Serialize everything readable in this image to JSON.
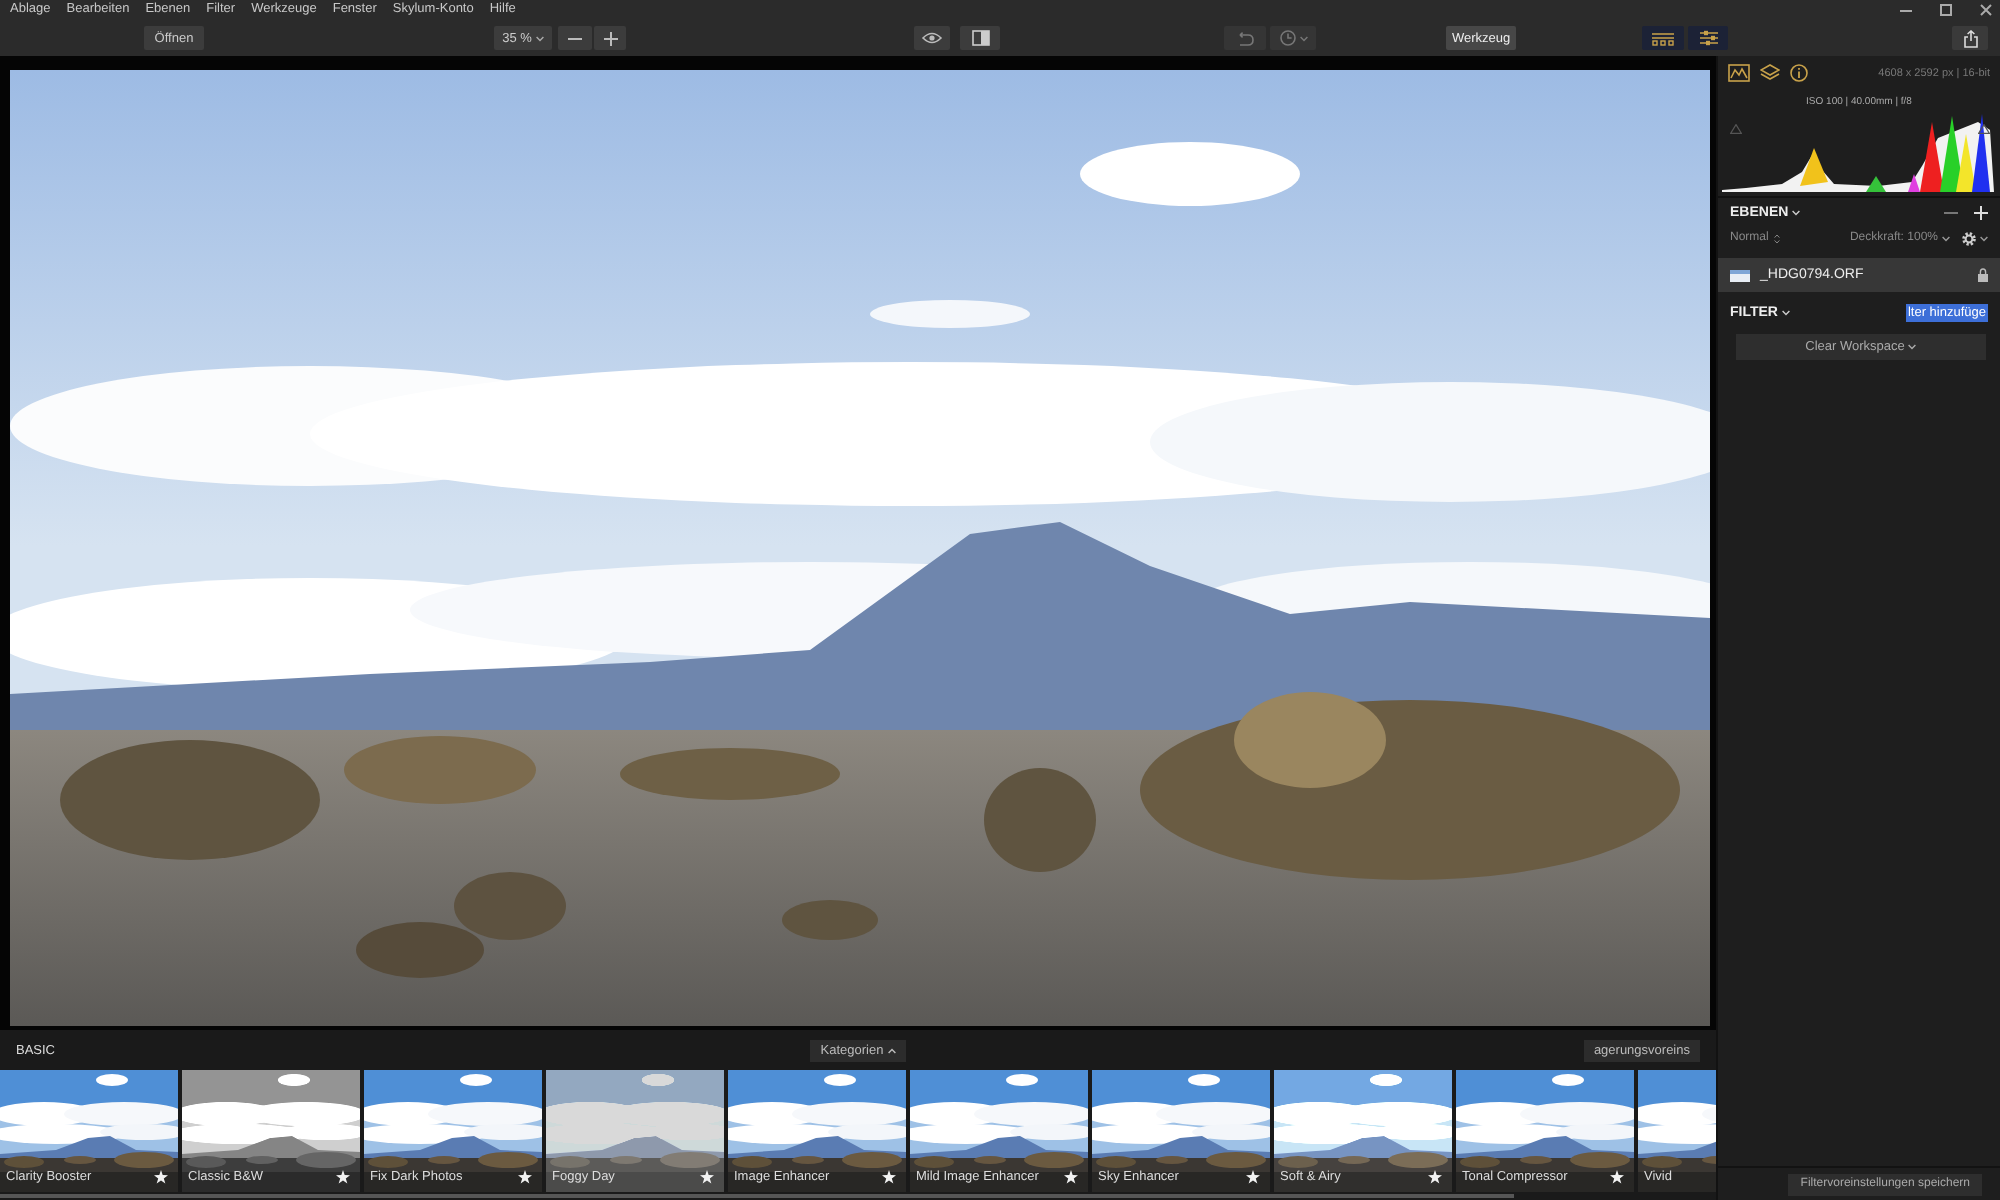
{
  "menu_bar": {
    "items": [
      "Ablage",
      "Bearbeiten",
      "Ebenen",
      "Filter",
      "Werkzeuge",
      "Fenster",
      "Skylum-Konto",
      "Hilfe"
    ]
  },
  "toolbar": {
    "open_button": "Öffnen",
    "zoom": "35 %",
    "tools_button": "Werkzeug"
  },
  "info": {
    "dimensions": "4608 x 2592 px | 16-bit",
    "exif": "ISO 100 | 40.00mm | f/8"
  },
  "layers": {
    "title": "EBENEN",
    "blend_mode": "Normal",
    "opacity": "Deckkraft: 100%",
    "items": [
      {
        "name": "_HDG0794.ORF",
        "selected": true
      }
    ]
  },
  "filters": {
    "title": "FILTER",
    "add_filter": {
      "label": "lter hinzufüge",
      "highlighted": true
    },
    "workspace_button": "Clear Workspace"
  },
  "presets": {
    "category": "BASIC",
    "categories_button": "Kategorien",
    "overlay_button": "agerungsvoreins",
    "items": [
      {
        "name": "Clarity Booster",
        "kind": "color",
        "favorite": true
      },
      {
        "name": "Classic B&W",
        "kind": "mono",
        "favorite": true
      },
      {
        "name": "Fix Dark Photos",
        "kind": "color",
        "favorite": true
      },
      {
        "name": "Foggy Day",
        "kind": "faded",
        "favorite": true
      },
      {
        "name": "Image Enhancer",
        "kind": "color",
        "favorite": true
      },
      {
        "name": "Mild Image Enhancer",
        "kind": "color",
        "favorite": true
      },
      {
        "name": "Sky Enhancer",
        "kind": "color",
        "favorite": true
      },
      {
        "name": "Soft & Airy",
        "kind": "bright",
        "favorite": true
      },
      {
        "name": "Tonal Compressor",
        "kind": "color",
        "favorite": true
      },
      {
        "name": "Vivid",
        "kind": "color",
        "favorite": false
      }
    ],
    "save_button": "Filtervoreinstellungen speichern"
  }
}
